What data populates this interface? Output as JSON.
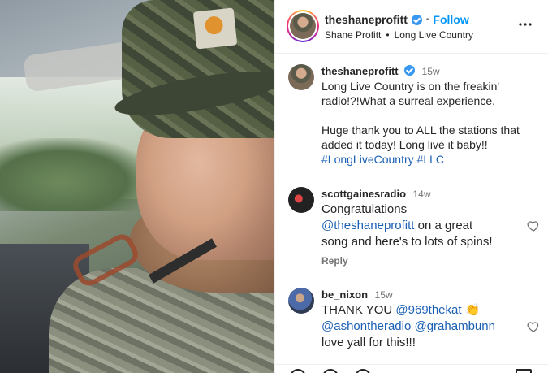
{
  "post": {
    "username": "theshaneprofitt",
    "follow_label": "Follow",
    "dot": "•",
    "subtitle_name": "Shane Profitt",
    "subtitle_sep": "•",
    "subtitle_song": "Long Live Country",
    "more_icon": "more-horizontal-icon"
  },
  "comments": [
    {
      "username": "theshaneprofitt",
      "time": "15w",
      "line1": "Long Live Country is on the freakin'",
      "line2": "radio!?!What a surreal experience.",
      "line3": "Huge thank you to ALL the stations that",
      "line4": "added it today! Long live it baby!!",
      "hashtag1": "#LongLiveCountry",
      "hashtag2": "#LLC"
    },
    {
      "username": "scottgainesradio",
      "time": "14w",
      "line1": "Congratulations",
      "mention": "@theshaneprofitt",
      "line2_rest": " on a great",
      "line3": "song and here's to lots of spins!",
      "reply": "Reply"
    },
    {
      "username": "be_nixon",
      "time": "15w",
      "line1_start": "THANK YOU ",
      "mention1": "@969thekat",
      "emoji": "👏",
      "mention2": "@ashontheradio",
      "mention3": "@grahambunn",
      "line3": "love yall for this!!!"
    }
  ],
  "colors": {
    "verified": "#3897f0",
    "follow": "#0095f6",
    "hashtag": "#1a5fb4"
  }
}
